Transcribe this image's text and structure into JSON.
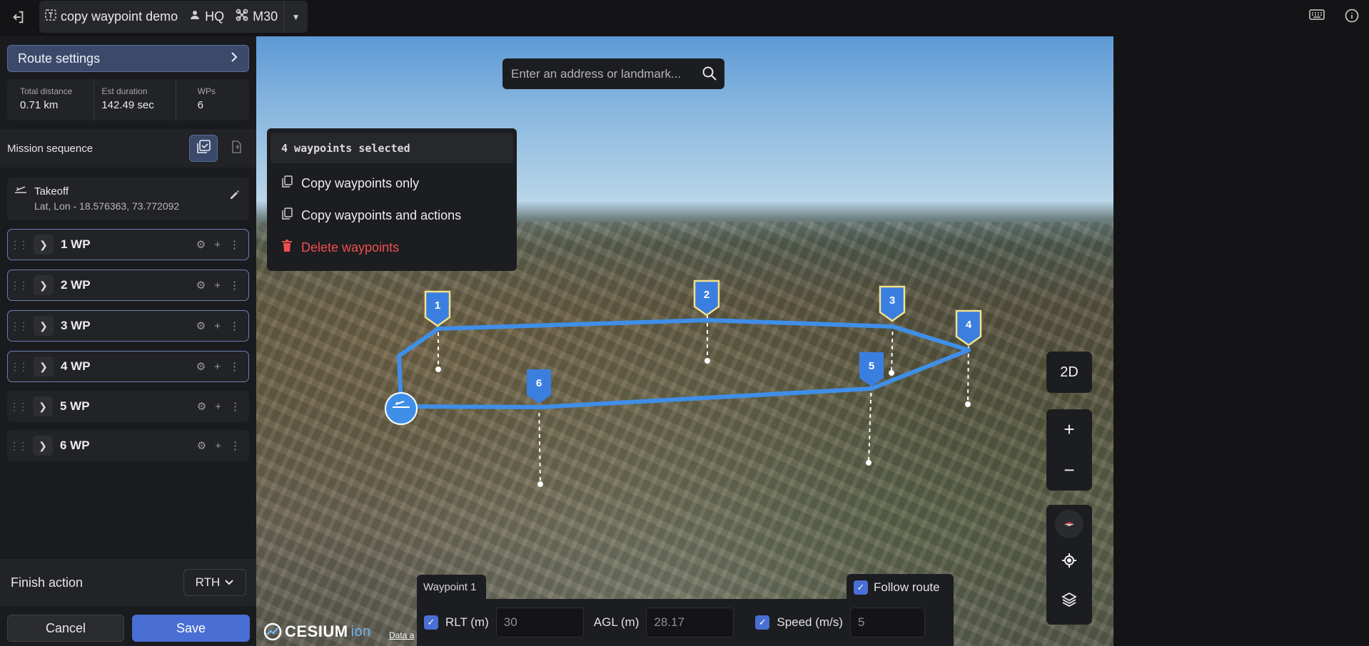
{
  "topbar": {
    "mission_name": "copy waypoint demo",
    "site": "HQ",
    "drone": "M30"
  },
  "sidebar": {
    "route_settings_label": "Route settings",
    "stats": [
      {
        "label": "Total distance",
        "value": "0.71 km"
      },
      {
        "label": "Est duration",
        "value": "142.49 sec"
      },
      {
        "label": "WPs",
        "value": "6"
      }
    ],
    "mission_sequence_label": "Mission sequence",
    "takeoff": {
      "title": "Takeoff",
      "coords": "Lat, Lon - 18.576363, 73.772092"
    },
    "waypoints": [
      {
        "label": "1 WP",
        "selected": true
      },
      {
        "label": "2 WP",
        "selected": true
      },
      {
        "label": "3 WP",
        "selected": true
      },
      {
        "label": "4 WP",
        "selected": true
      },
      {
        "label": "5 WP",
        "selected": false
      },
      {
        "label": "6 WP",
        "selected": false
      }
    ],
    "finish_action_label": "Finish action",
    "finish_action_value": "RTH",
    "cancel_label": "Cancel",
    "save_label": "Save"
  },
  "map": {
    "search_placeholder": "Enter an address or landmark...",
    "context_menu": {
      "header": "4 waypoints selected",
      "items": [
        {
          "label": "Copy waypoints only",
          "icon": "copy-icon"
        },
        {
          "label": "Copy waypoints and actions",
          "icon": "copy-icon"
        },
        {
          "label": "Delete waypoints",
          "icon": "trash-icon",
          "color": "#ee4f4f"
        }
      ]
    },
    "view_mode_label": "2D",
    "zoom_in": "+",
    "zoom_out": "−",
    "markers": [
      "1",
      "2",
      "3",
      "4",
      "5",
      "6"
    ],
    "attribution": {
      "brand": "CESIUM",
      "brand_suffix": "ion",
      "data_link": "Data a"
    }
  },
  "waypoint_panel": {
    "tab_label": "Waypoint 1",
    "follow_route_label": "Follow route",
    "rlt_label": "RLT (m)",
    "rlt_value": "30",
    "agl_label": "AGL (m)",
    "agl_value": "28.17",
    "speed_label": "Speed (m/s)",
    "speed_value": "5"
  },
  "colors": {
    "accent": "#4a6fd4",
    "route_line": "#3f8fe8",
    "danger": "#ee4f4f",
    "selected_marker_outline": "#f3e08a"
  }
}
